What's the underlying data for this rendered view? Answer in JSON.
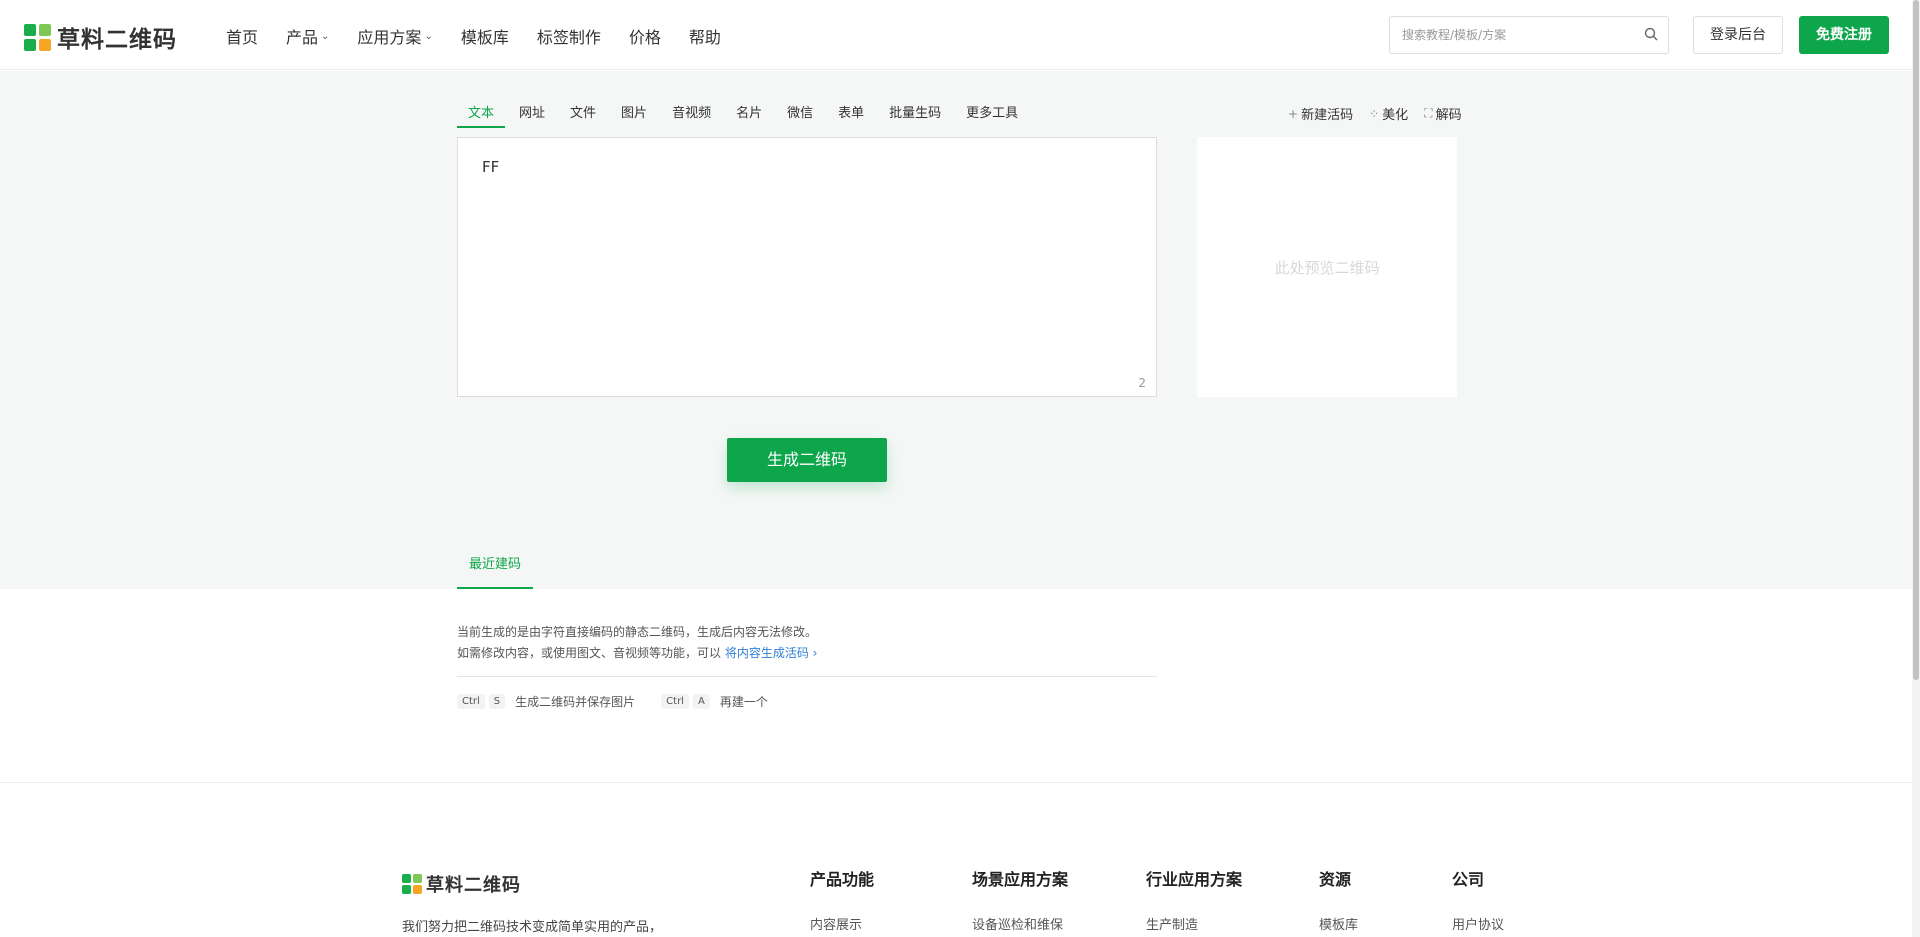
{
  "header": {
    "logo_text": "草料二维码",
    "nav": [
      {
        "label": "首页",
        "has_dropdown": false
      },
      {
        "label": "产品",
        "has_dropdown": true
      },
      {
        "label": "应用方案",
        "has_dropdown": true
      },
      {
        "label": "模板库",
        "has_dropdown": false
      },
      {
        "label": "标签制作",
        "has_dropdown": false
      },
      {
        "label": "价格",
        "has_dropdown": false
      },
      {
        "label": "帮助",
        "has_dropdown": false
      }
    ],
    "search_placeholder": "搜索教程/模板/方案",
    "login_label": "登录后台",
    "register_label": "免费注册"
  },
  "tabs": [
    "文本",
    "网址",
    "文件",
    "图片",
    "音视频",
    "名片",
    "微信",
    "表单",
    "批量生码",
    "更多工具"
  ],
  "active_tab": "文本",
  "tools": [
    {
      "icon": "plus-icon",
      "label": "新建活码"
    },
    {
      "icon": "sparkle-icon",
      "label": "美化"
    },
    {
      "icon": "scan-icon",
      "label": "解码"
    }
  ],
  "editor": {
    "value": "FF",
    "char_count": "2"
  },
  "preview": {
    "placeholder": "此处预览二维码"
  },
  "generate_label": "生成二维码",
  "recent_tab_label": "最近建码",
  "notice": {
    "line1": "当前生成的是由字符直接编码的静态二维码，生成后内容无法修改。",
    "line2": "如需修改内容，或使用图文、音视频等功能，可以",
    "link": "将内容生成活码 ›"
  },
  "shortcuts": [
    {
      "keys": [
        "Ctrl",
        "S"
      ],
      "label": "生成二维码并保存图片"
    },
    {
      "keys": [
        "Ctrl",
        "A"
      ],
      "label": "再建一个"
    }
  ],
  "footer": {
    "logo_text": "草料二维码",
    "description": "我们努力把二维码技术变成简单实用的产品，",
    "columns": [
      {
        "title": "产品功能",
        "first_item": "内容展示"
      },
      {
        "title": "场景应用方案",
        "first_item": "设备巡检和维保"
      },
      {
        "title": "行业应用方案",
        "first_item": "生产制造"
      },
      {
        "title": "资源",
        "first_item": "模板库"
      },
      {
        "title": "公司",
        "first_item": "用户协议"
      }
    ]
  },
  "colors": {
    "brand_green": "#0ea64b",
    "link_blue": "#2f7fd6",
    "page_grey": "#f5f7f6"
  }
}
